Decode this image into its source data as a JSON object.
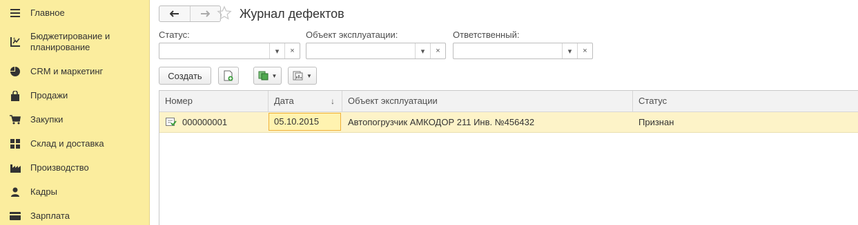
{
  "sidebar": {
    "items": [
      {
        "label": "Главное",
        "icon": "menu-lines-icon"
      },
      {
        "label": "Бюджетирование и планирование",
        "icon": "budget-chart-icon"
      },
      {
        "label": "CRM и маркетинг",
        "icon": "pie-chart-icon"
      },
      {
        "label": "Продажи",
        "icon": "shopping-bag-icon"
      },
      {
        "label": "Закупки",
        "icon": "cart-icon"
      },
      {
        "label": "Склад и доставка",
        "icon": "warehouse-grid-icon"
      },
      {
        "label": "Производство",
        "icon": "factory-icon"
      },
      {
        "label": "Кадры",
        "icon": "person-icon"
      },
      {
        "label": "Зарплата",
        "icon": "wallet-icon"
      }
    ]
  },
  "header": {
    "title": "Журнал дефектов"
  },
  "filters": {
    "status": {
      "label": "Статус:",
      "value": ""
    },
    "object": {
      "label": "Объект эксплуатации:",
      "value": ""
    },
    "responsible": {
      "label": "Ответственный:",
      "value": ""
    }
  },
  "toolbar": {
    "create_label": "Создать"
  },
  "table": {
    "columns": [
      "Номер",
      "Дата",
      "Объект эксплуатации",
      "Статус"
    ],
    "sort_indicator": "↓",
    "rows": [
      {
        "number": "000000001",
        "date": "05.10.2015",
        "object": "Автопогрузчик АМКОДОР 211 Инв. №456432",
        "status": "Признан"
      }
    ]
  },
  "colors": {
    "sidebar_bg": "#fbed9e",
    "row_highlight": "#fdf3c8",
    "cell_focus_border": "#f0b13a"
  }
}
